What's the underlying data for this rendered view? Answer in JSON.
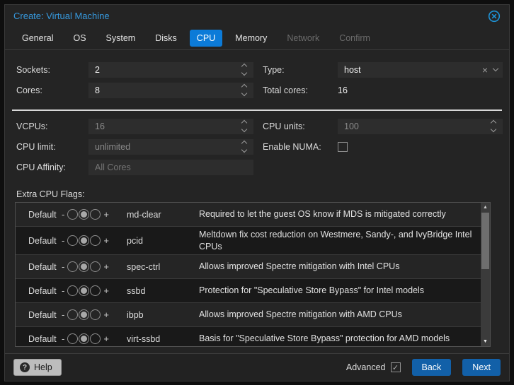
{
  "window": {
    "title": "Create: Virtual Machine"
  },
  "tabs": [
    {
      "label": "General",
      "state": "normal"
    },
    {
      "label": "OS",
      "state": "normal"
    },
    {
      "label": "System",
      "state": "normal"
    },
    {
      "label": "Disks",
      "state": "normal"
    },
    {
      "label": "CPU",
      "state": "active"
    },
    {
      "label": "Memory",
      "state": "normal"
    },
    {
      "label": "Network",
      "state": "disabled"
    },
    {
      "label": "Confirm",
      "state": "disabled"
    }
  ],
  "form": {
    "sockets": {
      "label": "Sockets:",
      "value": "2"
    },
    "cores": {
      "label": "Cores:",
      "value": "8"
    },
    "type": {
      "label": "Type:",
      "value": "host"
    },
    "total_cores": {
      "label": "Total cores:",
      "value": "16"
    },
    "vcpus": {
      "label": "VCPUs:",
      "value": "16"
    },
    "cpu_units": {
      "label": "CPU units:",
      "value": "100"
    },
    "cpu_limit": {
      "label": "CPU limit:",
      "value": "unlimited"
    },
    "enable_numa": {
      "label": "Enable NUMA:",
      "checked": false
    },
    "cpu_affinity": {
      "label": "CPU Affinity:",
      "placeholder": "All Cores"
    }
  },
  "flags": {
    "label": "Extra CPU Flags:",
    "rows": [
      {
        "state": "Default",
        "flag": "md-clear",
        "desc": "Required to let the guest OS know if MDS is mitigated correctly"
      },
      {
        "state": "Default",
        "flag": "pcid",
        "desc": "Meltdown fix cost reduction on Westmere, Sandy-, and IvyBridge Intel CPUs"
      },
      {
        "state": "Default",
        "flag": "spec-ctrl",
        "desc": "Allows improved Spectre mitigation with Intel CPUs"
      },
      {
        "state": "Default",
        "flag": "ssbd",
        "desc": "Protection for \"Speculative Store Bypass\" for Intel models"
      },
      {
        "state": "Default",
        "flag": "ibpb",
        "desc": "Allows improved Spectre mitigation with AMD CPUs"
      },
      {
        "state": "Default",
        "flag": "virt-ssbd",
        "desc": "Basis for \"Speculative Store Bypass\" protection for AMD models"
      }
    ]
  },
  "footer": {
    "help": "Help",
    "advanced": "Advanced",
    "advanced_checked": true,
    "back": "Back",
    "next": "Next"
  },
  "icons": {
    "minus": "-",
    "plus": "+",
    "clear_x": "×",
    "question": "?",
    "check": "✓",
    "scroll_up": "▲",
    "scroll_down": "▼"
  },
  "colors": {
    "accent_tab": "#0c7bd8",
    "accent_button": "#1260a8",
    "title_blue": "#3698dc",
    "dialog_bg": "#242424",
    "field_bg": "#2d2d2d",
    "row_light": "#252525",
    "row_dark": "#191919"
  }
}
